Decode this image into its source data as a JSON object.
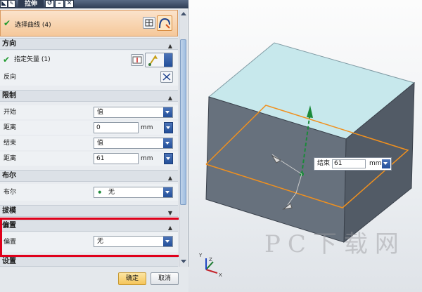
{
  "window": {
    "title": "拉伸",
    "buttons": [
      "↺",
      "–",
      "✕"
    ],
    "close_label": "✕"
  },
  "select_curve": {
    "label": "选择曲线 (4)"
  },
  "direction": {
    "header": "方向",
    "vector_label": "指定矢量 (1)",
    "reverse_label": "反向"
  },
  "limits": {
    "header": "限制",
    "start_label": "开始",
    "start_value": "值",
    "start_distance_label": "距离",
    "start_distance_value": "0",
    "end_label": "结束",
    "end_value": "值",
    "end_distance_label": "距离",
    "end_distance_value": "61",
    "unit": "mm"
  },
  "boolean": {
    "header": "布尔",
    "label": "布尔",
    "value": "无"
  },
  "draft": {
    "header": "拔模"
  },
  "offset": {
    "header": "偏置",
    "label": "偏置",
    "value": "无"
  },
  "settings": {
    "header": "设置"
  },
  "footer": {
    "ok_label": "确定",
    "cancel_label": "取消"
  },
  "viewport": {
    "onscreen_label": "结束",
    "onscreen_value": "61",
    "onscreen_unit": "mm",
    "axis_labels": [
      "Y",
      "X",
      "Z"
    ],
    "watermark": "PC下载网"
  },
  "colors": {
    "highlight": "#e0001b",
    "box_top": "#c7e8ec",
    "box_side": "#5e6773",
    "curve": "#f0901e",
    "vector": "#1b8a3a"
  }
}
